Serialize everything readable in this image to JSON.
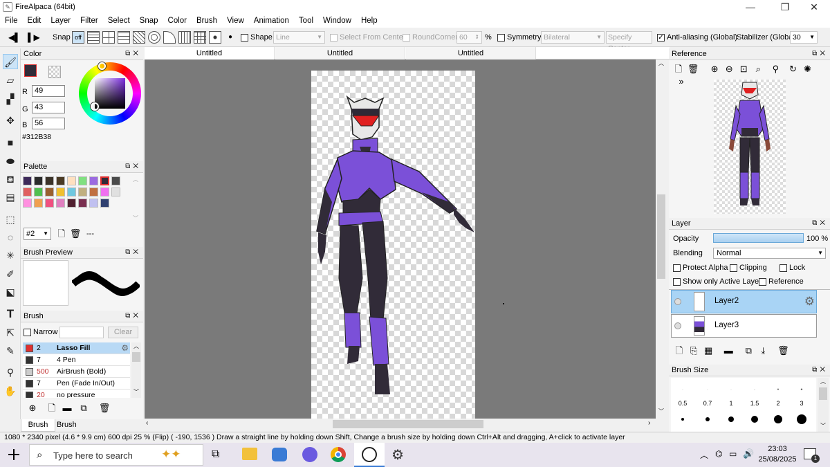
{
  "window": {
    "title": "FireAlpaca (64bit)",
    "minimize": "—",
    "maximize": "❐",
    "close": "✕"
  },
  "menu": [
    "File",
    "Edit",
    "Layer",
    "Filter",
    "Select",
    "Snap",
    "Color",
    "Brush",
    "View",
    "Animation",
    "Tool",
    "Window",
    "Help"
  ],
  "toolbar": {
    "snap_label": "Snap",
    "snap_off": "off",
    "shape_label": "Shape",
    "shape_value": "Line",
    "select_from_center": "Select From Center",
    "round_corner": "RoundCorner",
    "round_value": "60",
    "percent": "%",
    "symmetry": "Symmetry",
    "symmetry_value": "Bilateral",
    "specify_center": "Specify Center",
    "antialias": "Anti-aliasing (Global)",
    "stabilizer": "Stabilizer (Global)",
    "stabilizer_value": "30"
  },
  "color_panel": {
    "title": "Color",
    "r_label": "R",
    "r": "49",
    "g_label": "G",
    "g": "43",
    "b_label": "B",
    "b": "56",
    "hex": "#312B38",
    "fg": "#312b38"
  },
  "palette_panel": {
    "title": "Palette",
    "selector": "#2",
    "swatches": [
      "#3d2a5a",
      "#2b2b2b",
      "#3b3329",
      "#4a3a24",
      "#ffe0c0",
      "#80e080",
      "#9b6be0",
      "#312b38",
      "#4a4a4a",
      "#e06060",
      "#50c050",
      "#9a6030",
      "#f0c030",
      "#70c8e0",
      "#c0b080",
      "#c07040",
      "#f070f0",
      "#e0e0e0",
      "#ff90e0",
      "#f0a050",
      "#f05080",
      "#e080c0",
      "#502030",
      "#7a3050",
      "#c0c0f0",
      "#304070"
    ],
    "more": "---"
  },
  "brush_preview": {
    "title": "Brush Preview"
  },
  "brush_panel": {
    "title": "Brush",
    "narrow": "Narrow",
    "clear": "Clear",
    "items": [
      {
        "size": "2",
        "name": "Lasso Fill",
        "color": "#e03030"
      },
      {
        "size": "7",
        "name": "4 Pen",
        "color": "#333"
      },
      {
        "size": "500",
        "name": "AirBrush (Bold)",
        "color": "#ccc"
      },
      {
        "size": "7",
        "name": "Pen (Fade In/Out)",
        "color": "#333"
      },
      {
        "size": "20",
        "name": "no pressure",
        "color": "#333"
      }
    ],
    "tab_brush": "Brush",
    "tab_control": "Brush Control"
  },
  "tabs": [
    "Untitled",
    "Untitled",
    "Untitled"
  ],
  "reference_panel": {
    "title": "Reference"
  },
  "layer_panel": {
    "title": "Layer",
    "opacity_label": "Opacity",
    "opacity_value": "100 %",
    "opacity": 1.0,
    "blending_label": "Blending",
    "blending_value": "Normal",
    "protect_alpha": "Protect Alpha",
    "clipping": "Clipping",
    "lock": "Lock",
    "show_only_active": "Show only Active Layer",
    "reference": "Reference",
    "layers": [
      "Layer2",
      "Layer3"
    ]
  },
  "brush_size_panel": {
    "title": "Brush Size",
    "sizes": [
      "0.5",
      "0.7",
      "1",
      "1.5",
      "2",
      "3"
    ]
  },
  "status": "1080 * 2340 pixel  (4.6 * 9.9 cm)  600 dpi  25 % (Flip)  ( -190, 1536 )  Draw a straight line by holding down Shift, Change a brush size by holding down Ctrl+Alt and dragging, A+click to activate layer",
  "taskbar": {
    "search_placeholder": "Type here to search",
    "time": "23:03",
    "date": "25/08/2025",
    "notif": "1"
  }
}
